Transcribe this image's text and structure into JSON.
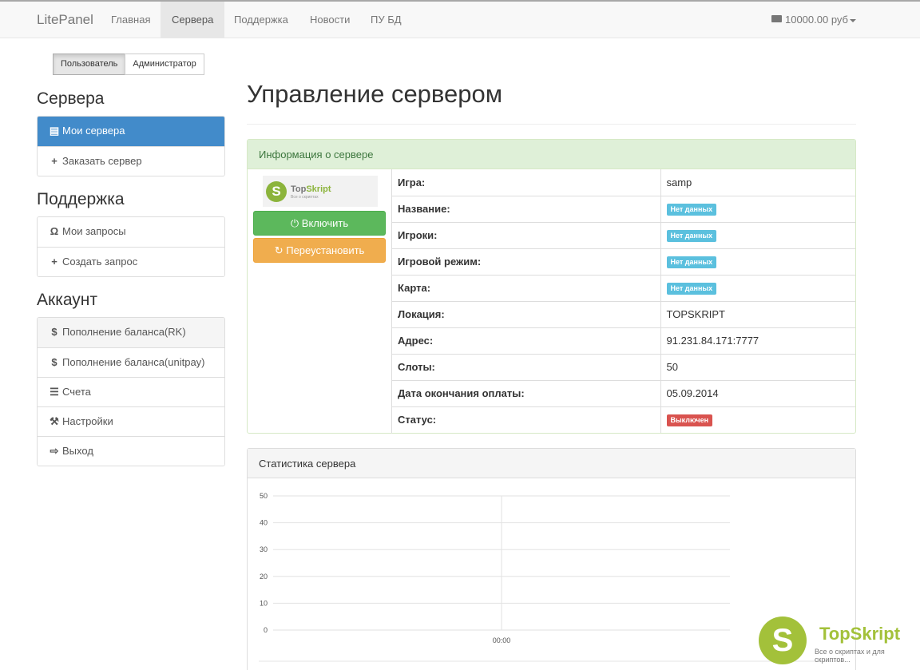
{
  "navbar": {
    "brand": "LitePanel",
    "items": [
      "Главная",
      "Сервера",
      "Поддержка",
      "Новости",
      "ПУ БД"
    ],
    "balance": "10000.00 руб"
  },
  "role_toggle": [
    "Пользователь",
    "Администратор"
  ],
  "sidebar": {
    "servers_heading": "Сервера",
    "servers_items": [
      "Мои сервера",
      "Заказать сервер"
    ],
    "support_heading": "Поддержка",
    "support_items": [
      "Мои запросы",
      "Создать запрос"
    ],
    "account_heading": "Аккаунт",
    "account_items": [
      "Пополнение баланса(RK)",
      "Пополнение баланса(unitpay)",
      "Счета",
      "Настройки",
      "Выход"
    ]
  },
  "main": {
    "title": "Управление сервером",
    "info_panel_title": "Информация о сервере",
    "logo": {
      "name_a": "Top",
      "name_b": "Skript",
      "tagline": "Все о скриптах"
    },
    "start_button": "Включить",
    "reinstall_button": "Переустановить",
    "info_rows": [
      {
        "key": "Игра:",
        "value": "samp",
        "type": "text"
      },
      {
        "key": "Название:",
        "value": "Нет данных",
        "type": "info"
      },
      {
        "key": "Игроки:",
        "value": "Нет данных",
        "type": "info"
      },
      {
        "key": "Игровой режим:",
        "value": "Нет данных",
        "type": "info"
      },
      {
        "key": "Карта:",
        "value": "Нет данных",
        "type": "info"
      },
      {
        "key": "Локация:",
        "value": "TOPSKRIPT",
        "type": "text"
      },
      {
        "key": "Адрес:",
        "value": "91.231.84.171:7777",
        "type": "text"
      },
      {
        "key": "Слоты:",
        "value": "50",
        "type": "text"
      },
      {
        "key": "Дата окончания оплаты:",
        "value": "05.09.2014",
        "type": "text"
      },
      {
        "key": "Статус:",
        "value": "Выключен",
        "type": "danger"
      }
    ],
    "stats_panel_title": "Статистика сервера"
  },
  "chart_data": {
    "type": "line",
    "x": [
      "00:00"
    ],
    "series": [
      {
        "values": [
          0
        ]
      }
    ],
    "yticks": [
      0,
      10,
      20,
      30,
      40,
      50
    ],
    "ylim": [
      0,
      50
    ]
  },
  "watermark": {
    "title": "TopSkript",
    "subtitle": "Все о скриптах и для скриптов..."
  },
  "colors": {
    "primary": "#428bca",
    "success": "#5cb85c",
    "warning": "#f0ad4e",
    "info": "#5bc0de",
    "danger": "#d9534f",
    "brand_green": "#a3c13a"
  }
}
